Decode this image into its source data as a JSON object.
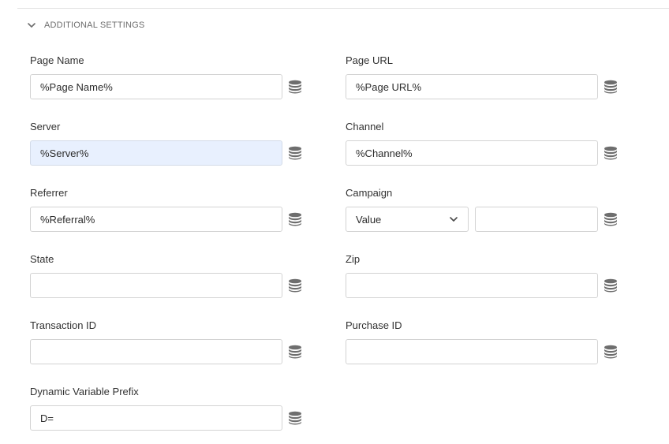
{
  "section": {
    "title": "ADDITIONAL SETTINGS",
    "expanded": true
  },
  "fields": {
    "page_name": {
      "label": "Page Name",
      "value": "%Page Name%",
      "placeholder": ""
    },
    "page_url": {
      "label": "Page URL",
      "value": "%Page URL%",
      "placeholder": ""
    },
    "server": {
      "label": "Server",
      "value": "%Server%",
      "placeholder": ""
    },
    "channel": {
      "label": "Channel",
      "value": "%Channel%",
      "placeholder": ""
    },
    "referrer": {
      "label": "Referrer",
      "value": "%Referral%",
      "placeholder": ""
    },
    "campaign": {
      "label": "Campaign",
      "select_value": "Value",
      "value": "",
      "placeholder": ""
    },
    "state": {
      "label": "State",
      "value": "",
      "placeholder": ""
    },
    "zip": {
      "label": "Zip",
      "value": "",
      "placeholder": ""
    },
    "transaction_id": {
      "label": "Transaction ID",
      "value": "",
      "placeholder": ""
    },
    "purchase_id": {
      "label": "Purchase ID",
      "value": "",
      "placeholder": ""
    },
    "dynamic_prefix": {
      "label": "Dynamic Variable Prefix",
      "value": "D=",
      "placeholder": ""
    }
  },
  "icons": {
    "data_element": "database-icon",
    "section_toggle": "chevron-down-icon",
    "select_toggle": "chevron-down-icon"
  },
  "colors": {
    "highlight_input_bg": "#e8f0fe",
    "border": "#d3d3d3",
    "icon": "#6e6e6e"
  }
}
